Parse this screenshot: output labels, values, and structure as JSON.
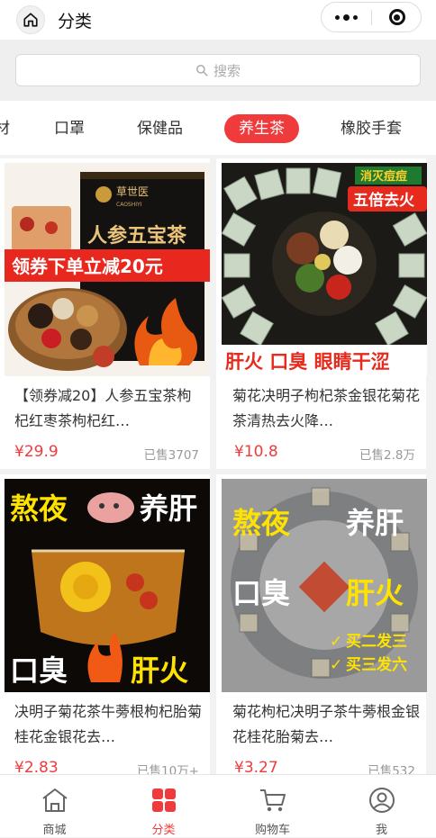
{
  "header": {
    "title": "分类",
    "home_icon": "home-icon",
    "more_icon": "more-dots-icon",
    "close_icon": "capsule-close-icon"
  },
  "search": {
    "placeholder": "搜索",
    "icon": "search-icon"
  },
  "tabs": [
    {
      "label": "材"
    },
    {
      "label": "口罩"
    },
    {
      "label": "保健品"
    },
    {
      "label": "养生茶",
      "active": true
    },
    {
      "label": "橡胶手套"
    }
  ],
  "products": [
    {
      "name": "【领券减20】人参五宝茶枸杞红枣茶枸杞红…",
      "price": "¥29.9",
      "sold": "已售3707",
      "image_text": {
        "brand": "草世医",
        "brand_en": "CAOSHIYI",
        "box_title": "人参五宝茶",
        "banner": "领券下单立减20元"
      }
    },
    {
      "name": "菊花决明子枸杞茶金银花菊花茶清热去火降…",
      "price": "¥10.8",
      "sold": "已售2.8万",
      "image_text": {
        "tag1": "消灭痘痘",
        "tag2": "五倍去火",
        "bottom": "肝火  口臭  眼睛干涩"
      }
    },
    {
      "name": "决明子菊花茶牛蒡根枸杞胎菊桂花金银花去…",
      "price": "¥2.83",
      "sold": "已售10万+",
      "image_text": {
        "top_left": "熬夜",
        "top_right": "养肝",
        "bottom_left": "口臭",
        "bottom_right": "肝火"
      }
    },
    {
      "name": "菊花枸杞决明子茶牛蒡根金银花桂花胎菊去…",
      "price": "¥3.27",
      "sold": "已售532",
      "image_text": {
        "top_left": "熬夜",
        "top_right": "养肝",
        "mid_left": "口臭",
        "mid_right": "肝火",
        "promo1": "买二发三",
        "promo2": "买三发六"
      }
    }
  ],
  "bottom_nav": [
    {
      "label": "商城",
      "icon": "store-icon"
    },
    {
      "label": "分类",
      "icon": "category-grid-icon",
      "active": true
    },
    {
      "label": "购物车",
      "icon": "cart-icon"
    },
    {
      "label": "我",
      "icon": "user-icon"
    }
  ],
  "colors": {
    "accent": "#ef3b3b",
    "background": "#f2f2f2"
  }
}
